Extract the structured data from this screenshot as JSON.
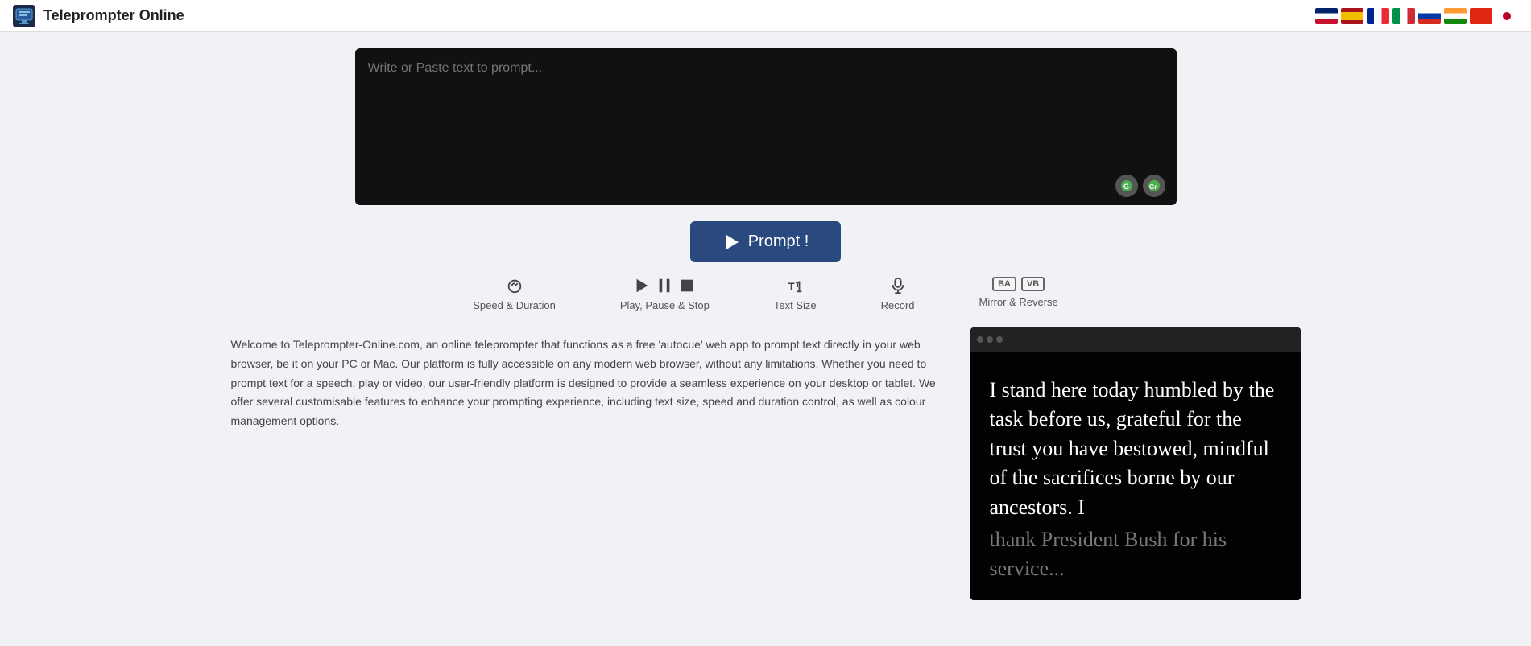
{
  "header": {
    "title": "Teleprompter Online",
    "logo_alt": "teleprompter-logo"
  },
  "flags": [
    {
      "name": "UK",
      "class": "flag-uk"
    },
    {
      "name": "Spain",
      "class": "flag-es"
    },
    {
      "name": "France",
      "class": "flag-fr"
    },
    {
      "name": "Italy",
      "class": "flag-it"
    },
    {
      "name": "Russia",
      "class": "flag-ru"
    },
    {
      "name": "India",
      "class": "flag-in"
    },
    {
      "name": "China",
      "class": "flag-cn"
    },
    {
      "name": "Japan",
      "class": "flag-jp"
    }
  ],
  "textarea": {
    "placeholder": "Write or Paste text to prompt..."
  },
  "prompt_button": {
    "label": "Prompt !"
  },
  "controls": [
    {
      "name": "speed-duration",
      "label": "Speed & Duration"
    },
    {
      "name": "play-pause-stop",
      "label": "Play, Pause & Stop"
    },
    {
      "name": "text-size",
      "label": "Text Size"
    },
    {
      "name": "record",
      "label": "Record"
    },
    {
      "name": "mirror-reverse",
      "label": "Mirror & Reverse"
    }
  ],
  "description": "Welcome to Teleprompter-Online.com, an online teleprompter that functions as a free 'autocue' web app to prompt text directly in your web browser, be it on your PC or Mac. Our platform is fully accessible on any modern web browser, without any limitations. Whether you need to prompt text for a speech, play or video, our user-friendly platform is designed to provide a seamless experience on your desktop or tablet. We offer several customisable features to enhance your prompting experience, including text size, speed and duration control, as well as colour management options.",
  "teleprompter_preview": {
    "text": "I stand here today humbled by the task before us, grateful for the trust you have bestowed, mindful of the sacrifices borne by our ancestors. I",
    "text_fade": "thank President Bush for his service..."
  },
  "mirror_labels": {
    "a_label": "BA",
    "b_label": "VB"
  }
}
